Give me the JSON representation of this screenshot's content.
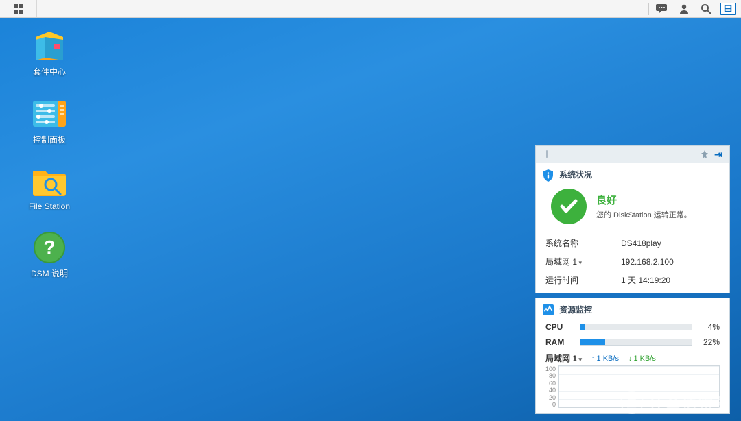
{
  "desktop": {
    "icons": [
      {
        "label": "套件中心"
      },
      {
        "label": "控制面板"
      },
      {
        "label": "File Station"
      },
      {
        "label": "DSM 说明"
      }
    ]
  },
  "widget": {
    "status": {
      "title": "系统状况",
      "status_word": "良好",
      "status_sub": "您的 DiskStation 运转正常。",
      "rows": {
        "name_label": "系统名称",
        "name_value": "DS418play",
        "lan_label": "局域网 1",
        "lan_value": "192.168.2.100",
        "uptime_label": "运行时间",
        "uptime_value": "1 天 14:19:20"
      }
    },
    "resource": {
      "title": "资源监控",
      "cpu_label": "CPU",
      "cpu_pct": "4%",
      "cpu_fill": 4,
      "ram_label": "RAM",
      "ram_pct": "22%",
      "ram_fill": 22,
      "net_label": "局域网 1",
      "net_up": "1 KB/s",
      "net_down": "1 KB/s",
      "y_ticks": [
        "100",
        "80",
        "60",
        "40",
        "20",
        "0"
      ]
    }
  },
  "watermark": "什么值得买"
}
